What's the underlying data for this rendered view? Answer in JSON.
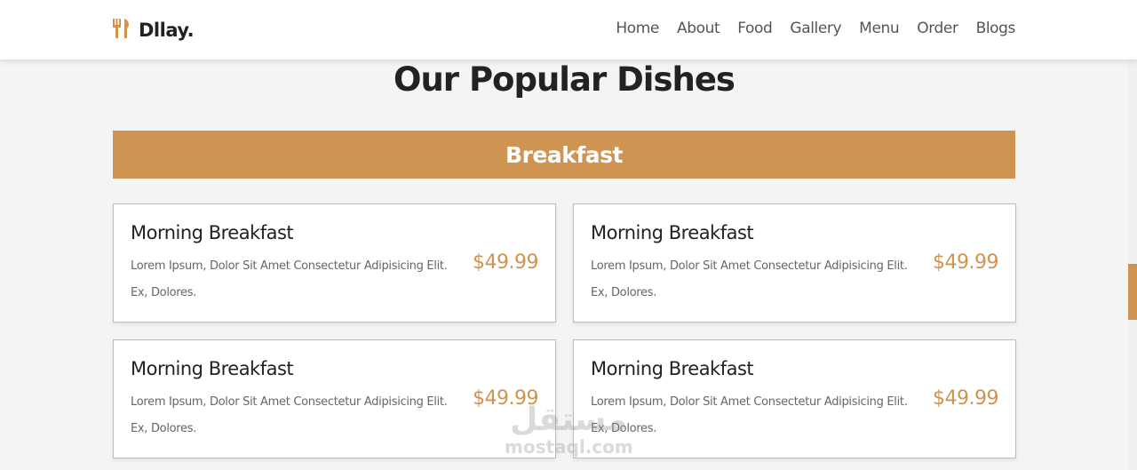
{
  "header": {
    "logo_icon": "fork-knife-icon",
    "logo_text": "Dllay.",
    "nav": [
      "Home",
      "About",
      "Food",
      "Gallery",
      "Menu",
      "Order",
      "Blogs"
    ]
  },
  "main": {
    "title": "Our Popular Dishes",
    "category": "Breakfast",
    "cards": [
      {
        "title": "Morning Breakfast",
        "description": "Lorem Ipsum, Dolor Sit Amet Consectetur Adipisicing Elit. Ex, Dolores.",
        "price": "$49.99"
      },
      {
        "title": "Morning Breakfast",
        "description": "Lorem Ipsum, Dolor Sit Amet Consectetur Adipisicing Elit. Ex, Dolores.",
        "price": "$49.99"
      },
      {
        "title": "Morning Breakfast",
        "description": "Lorem Ipsum, Dolor Sit Amet Consectetur Adipisicing Elit. Ex, Dolores.",
        "price": "$49.99"
      },
      {
        "title": "Morning Breakfast",
        "description": "Lorem Ipsum, Dolor Sit Amet Consectetur Adipisicing Elit. Ex, Dolores.",
        "price": "$49.99"
      }
    ]
  },
  "watermark": {
    "arabic": "مستقل",
    "latin": "mostaql.com"
  },
  "colors": {
    "accent": "#cf9452",
    "background": "#f4f4f4",
    "text": "#222222"
  }
}
